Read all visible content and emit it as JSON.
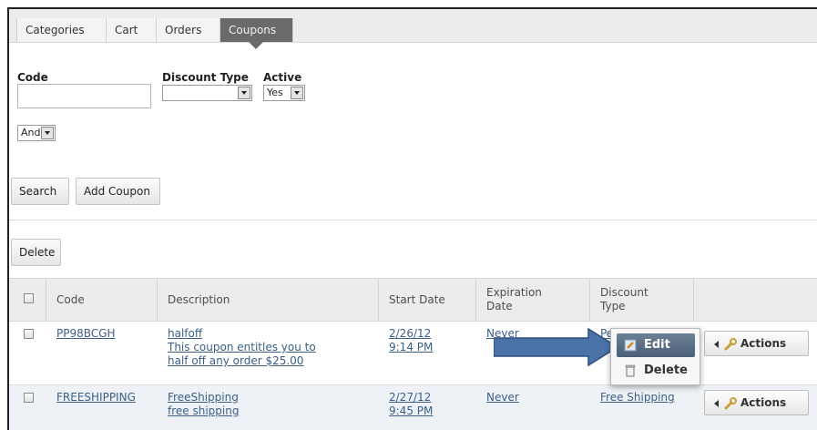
{
  "tabs": [
    {
      "label": "Categories"
    },
    {
      "label": "Cart"
    },
    {
      "label": "Orders"
    },
    {
      "label": "Coupons",
      "active": true
    }
  ],
  "filters": {
    "code_label": "Code",
    "code_value": "",
    "discount_type_label": "Discount Type",
    "discount_type_value": "",
    "active_label": "Active",
    "active_value": "Yes",
    "logic_value": "And"
  },
  "buttons": {
    "search": "Search",
    "add_coupon": "Add Coupon",
    "delete": "Delete"
  },
  "table": {
    "headers": {
      "code": "Code",
      "description": "Description",
      "start_date": "Start Date",
      "expiration_date": "Expiration Date",
      "discount_type": "Discount Type"
    },
    "rows": [
      {
        "code": "PP98BCGH",
        "name": "halfoff",
        "description": "This coupon entitles you to half off any order $25.00",
        "start_date": "2/26/12",
        "start_time": "9:14 PM",
        "expiration": "Never",
        "discount_type": "Percent",
        "actions_label": "Actions"
      },
      {
        "code": "FREESHIPPING",
        "name": "FreeShipping",
        "description": "free shipping",
        "start_date": "2/27/12",
        "start_time": "9:45 PM",
        "expiration": "Never",
        "discount_type": "Free Shipping",
        "actions_label": "Actions"
      }
    ]
  },
  "context_menu": {
    "edit": "Edit",
    "delete": "Delete"
  },
  "colors": {
    "active_tab": "#6a6a6a",
    "link": "#3b5f86",
    "annotation_arrow": "#4a74a8",
    "menu_highlight": "#55697f"
  }
}
